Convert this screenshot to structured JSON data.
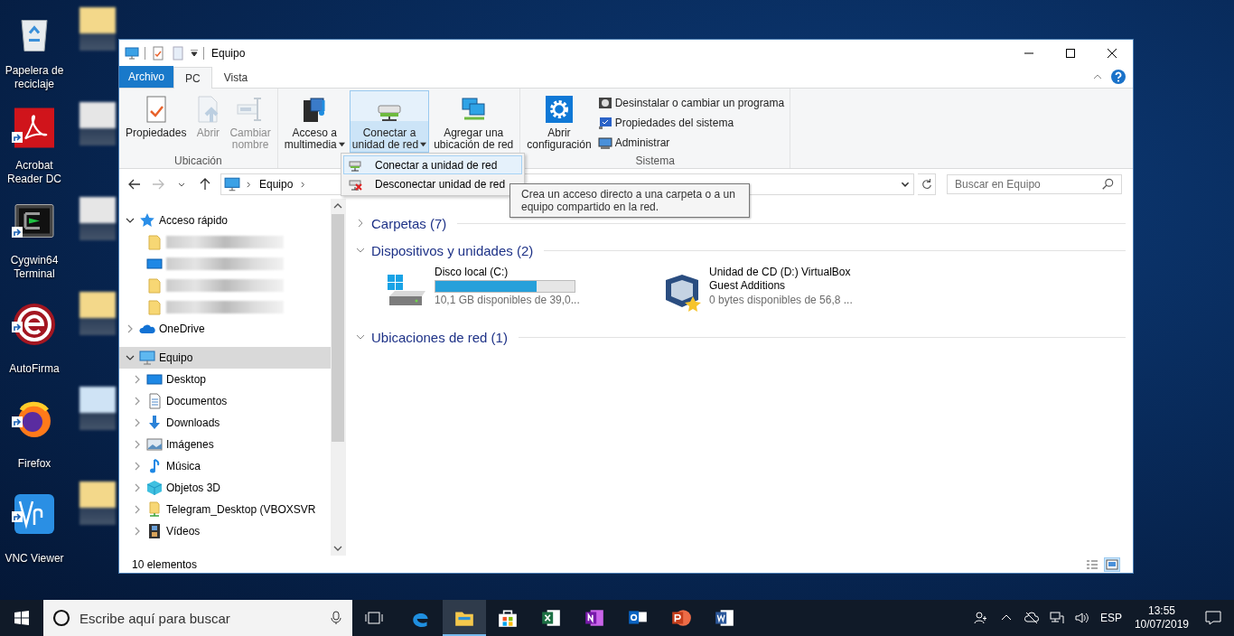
{
  "desktop": {
    "icons": [
      {
        "label": "Papelera de\nreciclaje",
        "kind": "recycle-bin",
        "shortcut": false
      },
      {
        "label": "Acrobat\nReader DC",
        "kind": "acrobat",
        "shortcut": true
      },
      {
        "label": "Cygwin64\nTerminal",
        "kind": "terminal",
        "shortcut": true
      },
      {
        "label": "AutoFirma",
        "kind": "autofirma",
        "shortcut": true
      },
      {
        "label": "Firefox",
        "kind": "firefox",
        "shortcut": true
      },
      {
        "label": "VNC Viewer",
        "kind": "vnc",
        "shortcut": true
      }
    ]
  },
  "window": {
    "title": "Equipo",
    "tabs": [
      {
        "label": "Archivo",
        "kind": "file",
        "selected": false
      },
      {
        "label": "PC",
        "kind": "tab",
        "selected": true
      },
      {
        "label": "Vista",
        "kind": "tab",
        "selected": false
      }
    ],
    "ribbon": {
      "groups": [
        {
          "label": "Ubicación",
          "buttons": [
            {
              "label": "Propiedades",
              "kind": "properties",
              "disabled": false,
              "dropdown": false,
              "pressed": false
            },
            {
              "label": "Abrir",
              "kind": "open",
              "disabled": true,
              "dropdown": false,
              "pressed": false
            },
            {
              "label": "Cambiar\nnombre",
              "kind": "rename",
              "disabled": true,
              "dropdown": false,
              "pressed": false
            }
          ]
        },
        {
          "buttons": [
            {
              "label": "Acceso a\nmultimedia",
              "kind": "media",
              "disabled": false,
              "dropdown": true,
              "pressed": false
            },
            {
              "label": "Conectar a\nunidad de red",
              "kind": "network-drive",
              "disabled": false,
              "dropdown": true,
              "pressed": true
            },
            {
              "label": "Agregar una\nubicación de red",
              "kind": "network-location",
              "disabled": false,
              "dropdown": false,
              "pressed": false
            }
          ]
        },
        {
          "label": "Sistema",
          "buttons": [
            {
              "label": "Abrir\nconfiguración",
              "kind": "settings",
              "disabled": false,
              "dropdown": false,
              "pressed": false
            }
          ],
          "small_buttons": [
            {
              "label": "Desinstalar o cambiar un programa",
              "kind": "uninstall"
            },
            {
              "label": "Propiedades del sistema",
              "kind": "system"
            },
            {
              "label": "Administrar",
              "kind": "manage"
            }
          ]
        }
      ]
    },
    "dropdown_menu": [
      {
        "label": "Conectar a unidad de red",
        "kind": "map-drive",
        "selected": true
      },
      {
        "label": "Desconectar unidad de red",
        "kind": "disconnect-drive",
        "selected": false
      }
    ],
    "tooltip": "Crea un acceso directo a una carpeta o a un equipo compartido en la red.",
    "address": {
      "path": [
        "Equipo"
      ]
    },
    "search": {
      "placeholder": "Buscar en Equipo"
    },
    "navigation": [
      {
        "label": "Acceso rápido",
        "kind": "star",
        "expanded": true,
        "selected": false,
        "children": [
          {
            "kind": "folder"
          },
          {
            "kind": "desktop"
          },
          {
            "kind": "folder"
          },
          {
            "kind": "folder"
          }
        ]
      },
      {
        "label": "OneDrive",
        "kind": "cloud",
        "expanded": false,
        "selected": false
      },
      {
        "label": "Equipo",
        "kind": "pc",
        "expanded": true,
        "selected": true,
        "children": [
          {
            "label": "Desktop",
            "kind": "desktop",
            "expanded": false,
            "selected": false
          },
          {
            "label": "Documentos",
            "kind": "document",
            "expanded": false,
            "selected": false
          },
          {
            "label": "Downloads",
            "kind": "download",
            "expanded": false,
            "selected": false
          },
          {
            "label": "Imágenes",
            "kind": "pictures",
            "expanded": false,
            "selected": false
          },
          {
            "label": "Música",
            "kind": "music",
            "expanded": false,
            "selected": false
          },
          {
            "label": "Objetos 3D",
            "kind": "cube",
            "expanded": false,
            "selected": false
          },
          {
            "label": "Telegram_Desktop (VBOXSVR",
            "kind": "network-folder",
            "expanded": false,
            "selected": false
          },
          {
            "label": "Vídeos",
            "kind": "film",
            "expanded": false,
            "selected": false
          }
        ]
      }
    ],
    "sections": [
      {
        "label": "Carpetas (7)",
        "expanded": false
      },
      {
        "label": "Dispositivos y unidades (2)",
        "expanded": true,
        "drives": [
          {
            "name": "Disco local (C:)",
            "kind": "hdd",
            "level": 0.73,
            "detail": "10,1 GB disponibles de 39,0..."
          },
          {
            "name": "Unidad de CD (D:) VirtualBox Guest Additions",
            "kind": "cd",
            "detail": "0 bytes disponibles de 56,8 ..."
          }
        ]
      },
      {
        "label": "Ubicaciones de red (1)",
        "expanded": true
      }
    ],
    "status_bar": {
      "count": "10 elementos",
      "views": [
        {
          "kind": "details",
          "selected": false
        },
        {
          "kind": "large-icons",
          "selected": true
        }
      ]
    }
  },
  "taskbar": {
    "search_placeholder": "Escribe aquí para buscar",
    "apps": [
      {
        "kind": "edge",
        "active": false
      },
      {
        "kind": "explorer",
        "active": true
      },
      {
        "kind": "store",
        "active": false
      },
      {
        "kind": "excel",
        "active": false
      },
      {
        "kind": "onenote",
        "active": false
      },
      {
        "kind": "outlook",
        "active": false
      },
      {
        "kind": "powerpoint",
        "active": false
      },
      {
        "kind": "word",
        "active": false
      }
    ],
    "language": "ESP",
    "time": "13:55",
    "date": "10/07/2019"
  }
}
